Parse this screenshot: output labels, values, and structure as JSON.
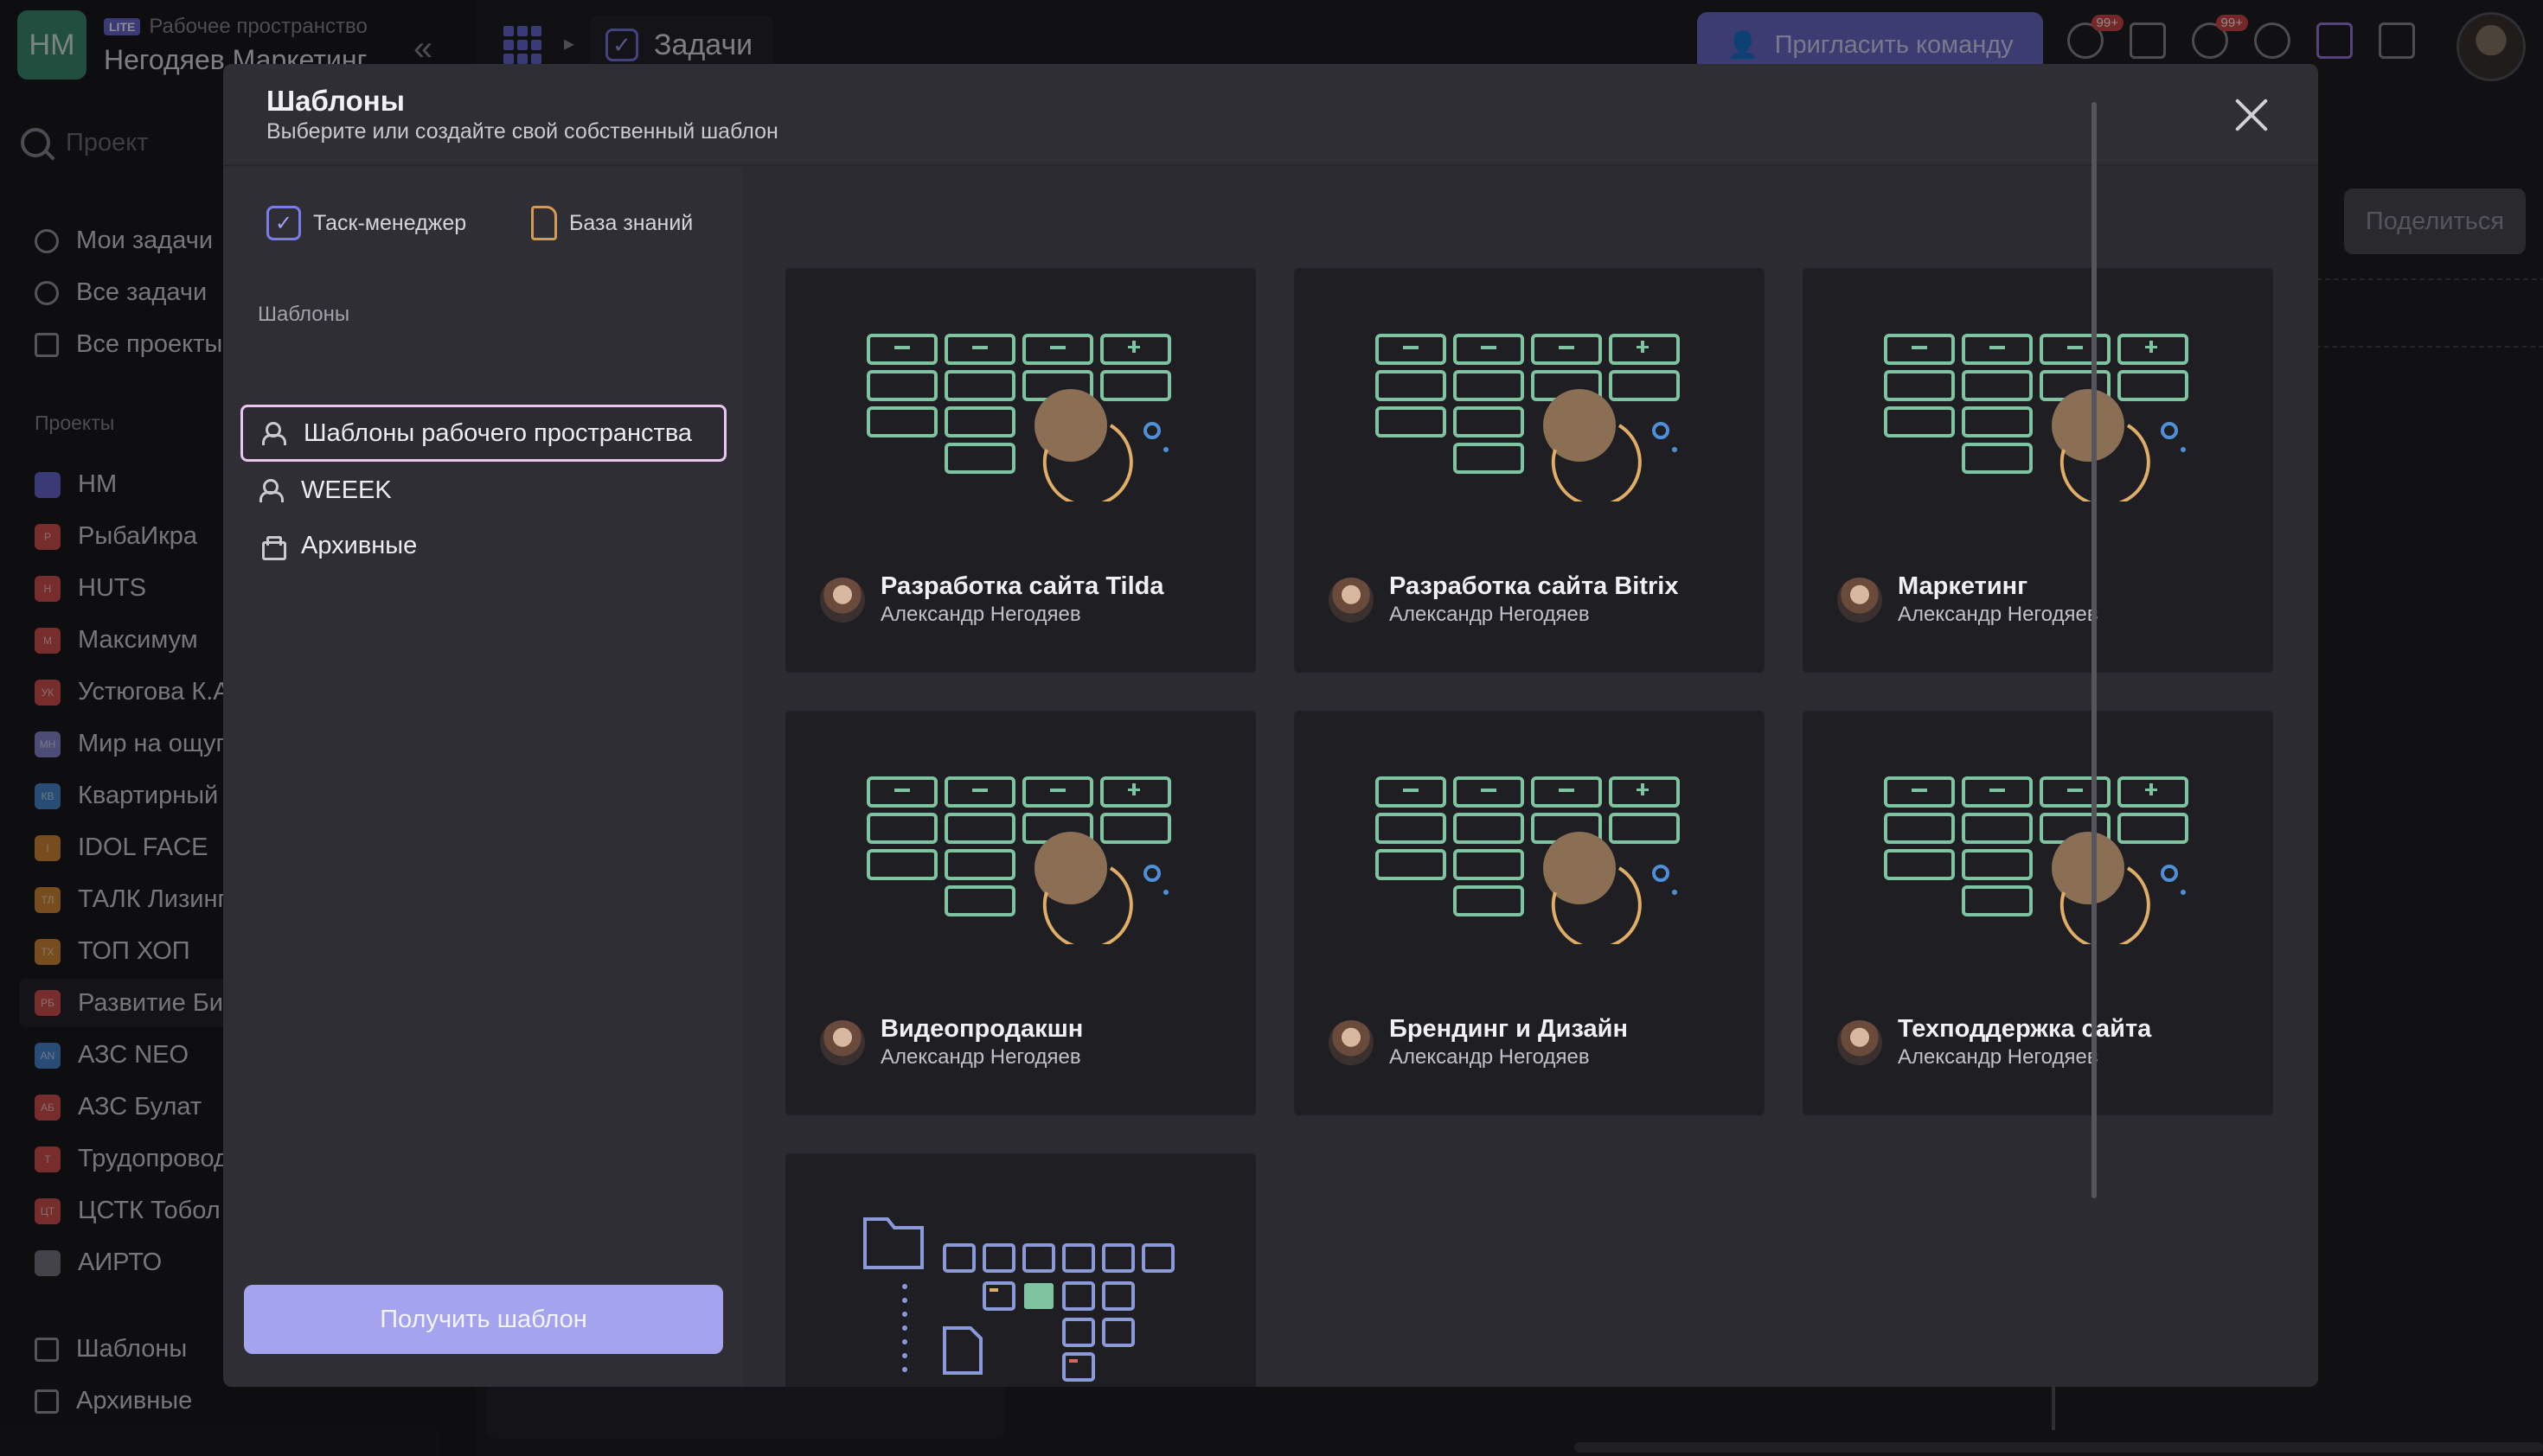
{
  "workspace": {
    "initials": "HM",
    "lite_badge": "LITE",
    "subtitle": "Рабочее пространство",
    "name": "Негодяев Маркетинг"
  },
  "sidebar": {
    "search_placeholder": "Проект",
    "nav": [
      {
        "label": "Мои задачи",
        "icon": "check-circle-icon"
      },
      {
        "label": "Все задачи",
        "icon": "check-circle-icon"
      },
      {
        "label": "Все проекты",
        "icon": "folder-icon"
      }
    ],
    "projects_label": "Проекты",
    "projects": [
      {
        "label": "HM",
        "badge": "",
        "color": "#6b6bd8"
      },
      {
        "label": "РыбаИкра",
        "badge": "P",
        "color": "#d9534f"
      },
      {
        "label": "HUTS",
        "badge": "H",
        "color": "#d9534f"
      },
      {
        "label": "Максимум",
        "badge": "M",
        "color": "#d9534f"
      },
      {
        "label": "Устюгова К.А.",
        "badge": "УК",
        "color": "#d9534f"
      },
      {
        "label": "Мир на ощупь",
        "badge": "МН",
        "color": "#8a8ad8"
      },
      {
        "label": "Квартирный",
        "badge": "КВ",
        "color": "#4a8ad8"
      },
      {
        "label": "IDOL FACE",
        "badge": "I",
        "color": "#d98a3a"
      },
      {
        "label": "ТАЛК Лизинг",
        "badge": "ТЛ",
        "color": "#d98a3a"
      },
      {
        "label": "ТОП ХОП",
        "badge": "ТХ",
        "color": "#d98a3a"
      },
      {
        "label": "Развитие Би",
        "badge": "РБ",
        "color": "#d9534f"
      },
      {
        "label": "АЗС NEO",
        "badge": "AN",
        "color": "#4a8ad8"
      },
      {
        "label": "АЗС Булат",
        "badge": "АБ",
        "color": "#d9534f"
      },
      {
        "label": "Трудопровод",
        "badge": "Т",
        "color": "#d9534f"
      },
      {
        "label": "ЦСТК Тобол",
        "badge": "ЦТ",
        "color": "#d9534f"
      },
      {
        "label": "АИРТО",
        "badge": "",
        "color": "#7a7a85"
      }
    ],
    "bottom": [
      {
        "label": "Шаблоны",
        "icon": "template-icon"
      },
      {
        "label": "Архивные",
        "icon": "archive-icon"
      }
    ]
  },
  "topbar": {
    "breadcrumb": "Задачи",
    "invite_label": "Пригласить команду",
    "notif_badge": "99+",
    "help_badge": "99+"
  },
  "page": {
    "share_label": "Поделиться"
  },
  "modal": {
    "title": "Шаблоны",
    "subtitle": "Выберите или создайте свой собственный шаблон",
    "tabs": [
      {
        "label": "Таск-менеджер",
        "icon": "task-check-icon"
      },
      {
        "label": "База знаний",
        "icon": "document-icon"
      }
    ],
    "section_label": "Шаблоны",
    "categories": [
      {
        "label": "Шаблоны рабочего пространства",
        "active": true,
        "icon": "team-icon"
      },
      {
        "label": "WEEEK",
        "active": false,
        "icon": "team-icon"
      },
      {
        "label": "Архивные",
        "active": false,
        "icon": "archive-icon"
      }
    ],
    "get_button": "Получить шаблон",
    "cards": [
      {
        "title": "Разработка сайта Tilda",
        "author": "Александр Негодяев"
      },
      {
        "title": "Разработка сайта Bitrix",
        "author": "Александр Негодяев"
      },
      {
        "title": "Маркетинг",
        "author": "Александр Негодяев"
      },
      {
        "title": "Видеопродакшн",
        "author": "Александр Негодяев"
      },
      {
        "title": "Брендинг и Дизайн",
        "author": "Александр Негодяев"
      },
      {
        "title": "Техподдержка сайта",
        "author": "Александр Негодяев"
      }
    ]
  },
  "colors": {
    "accent": "#6b6bd8",
    "card_line": "#7fc4a0",
    "card_circle": "#8a6f55",
    "card_arc": "#e0ad67",
    "dot_blue": "#4f8fd8"
  }
}
